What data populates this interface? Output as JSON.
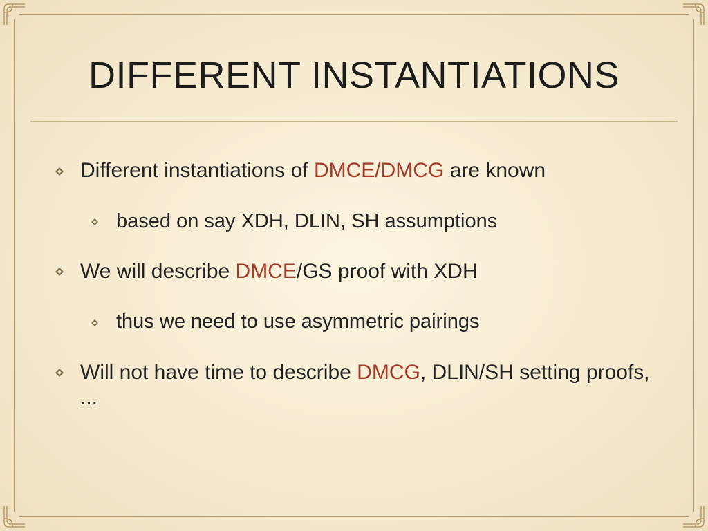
{
  "title": "DIFFERENT INSTANTIATIONS",
  "colors": {
    "highlight": "#a43a2a",
    "frame": "#b49a6a"
  },
  "bullets": {
    "b1_pre": "Different instantiations of ",
    "b1_hl": "DMCE/DMCG",
    "b1_post": " are known",
    "b1a": "based on say XDH, DLIN, SH assumptions",
    "b2_pre": "We will describe ",
    "b2_hl": "DMCE",
    "b2_post": "/GS proof with XDH",
    "b2a": "thus we need to use asymmetric pairings",
    "b3_pre": "Will not have time to describe ",
    "b3_hl": "DMCG",
    "b3_post": ", DLIN/SH setting proofs, ..."
  }
}
